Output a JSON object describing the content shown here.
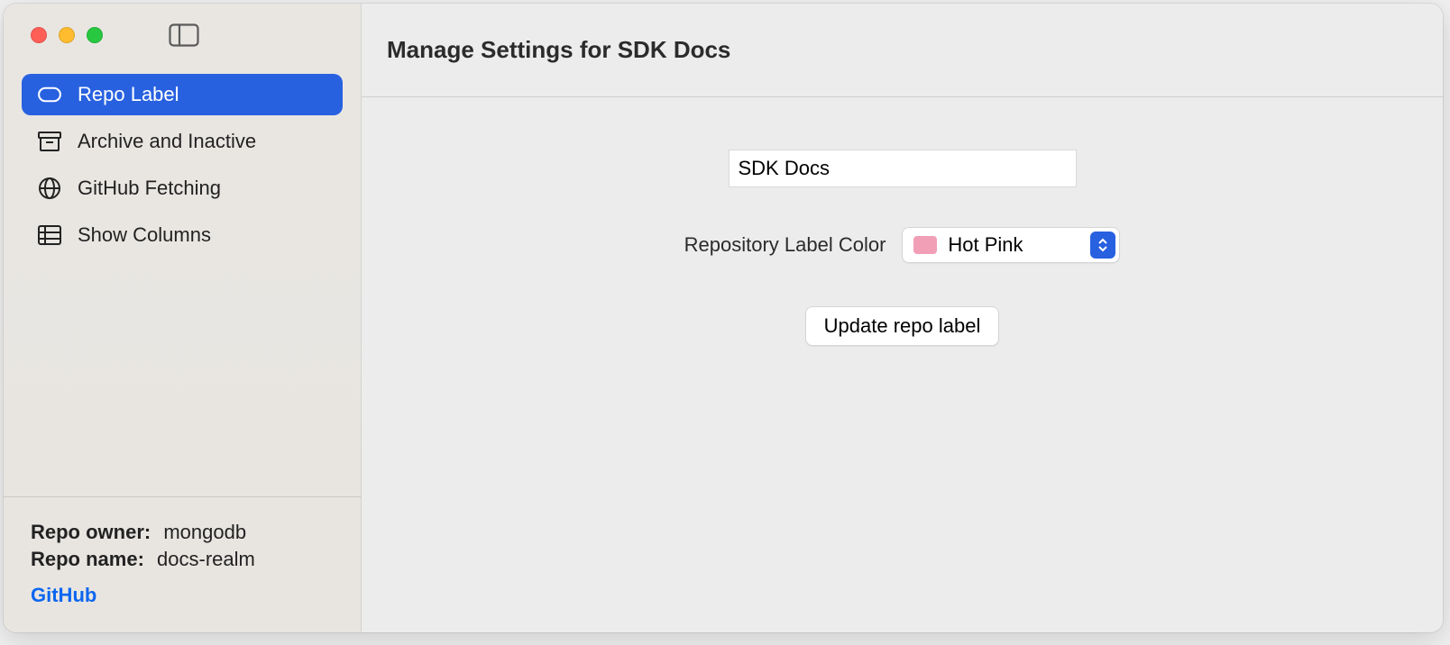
{
  "window": {
    "title": "Manage Settings for SDK Docs"
  },
  "sidebar": {
    "items": [
      {
        "label": "Repo Label",
        "icon": "pill-icon",
        "selected": true
      },
      {
        "label": "Archive and Inactive",
        "icon": "archive-box-icon",
        "selected": false
      },
      {
        "label": "GitHub Fetching",
        "icon": "globe-icon",
        "selected": false
      },
      {
        "label": "Show Columns",
        "icon": "list-columns-icon",
        "selected": false
      }
    ],
    "footer": {
      "owner_label": "Repo owner:",
      "owner_value": "mongodb",
      "name_label": "Repo name:",
      "name_value": "docs-realm",
      "github_link": "GitHub"
    }
  },
  "form": {
    "label_input_value": "SDK Docs",
    "color_label": "Repository Label Color",
    "color_selected": "Hot Pink",
    "color_swatch_hex": "#f19fb7",
    "update_button": "Update repo label"
  }
}
